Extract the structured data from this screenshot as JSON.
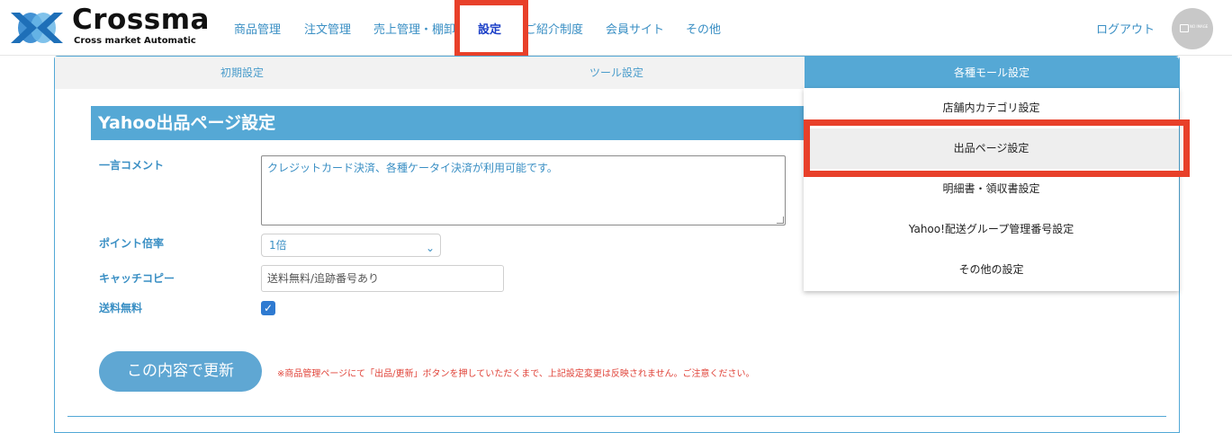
{
  "brand": {
    "name": "Crossma",
    "subtitle": "Cross market Automatic"
  },
  "nav": {
    "items": [
      {
        "label": "商品管理"
      },
      {
        "label": "注文管理"
      },
      {
        "label": "売上管理・棚卸"
      },
      {
        "label": "設定"
      },
      {
        "label": "ご紹介制度"
      },
      {
        "label": "会員サイト"
      },
      {
        "label": "その他"
      }
    ],
    "logout": "ログアウト",
    "avatar_text": "NO IMAGE"
  },
  "tabs": [
    {
      "label": "初期設定"
    },
    {
      "label": "ツール設定"
    },
    {
      "label": "各種モール設定"
    }
  ],
  "dropdown": {
    "items": [
      {
        "label": "店舗内カテゴリ設定"
      },
      {
        "label": "出品ページ設定"
      },
      {
        "label": "明細書・領収書設定"
      },
      {
        "label": "Yahoo!配送グループ管理番号設定"
      },
      {
        "label": "その他の設定"
      }
    ]
  },
  "form": {
    "title": "Yahoo出品ページ設定",
    "comment_label": "一言コメント",
    "comment_value": "クレジットカード決済、各種ケータイ決済が利用可能です。",
    "point_label": "ポイント倍率",
    "point_value": "1倍",
    "catch_label": "キャッチコピー",
    "catch_value": "送料無料/追跡番号あり",
    "free_ship_label": "送料無料",
    "free_ship_checked": true,
    "submit_label": "この内容で更新",
    "note": "※商品管理ページにて「出品/更新」ボタンを押していただくまで、上記設定変更は反映されません。ご注意ください。"
  },
  "colors": {
    "accent": "#55a8d5",
    "highlight": "#e8402a",
    "link": "#3a8fc4",
    "warning": "#e0443a"
  }
}
